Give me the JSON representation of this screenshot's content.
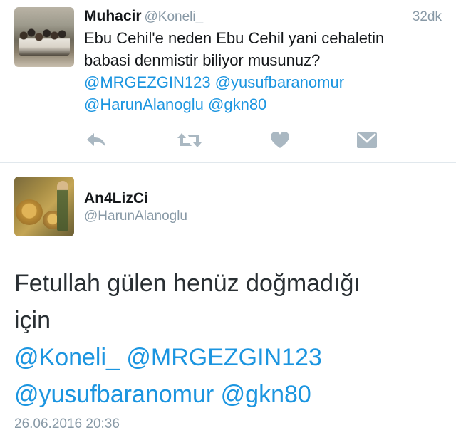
{
  "tweet1": {
    "display_name": "Muhacir",
    "handle": "@Koneli_",
    "time_ago": "32dk",
    "text_line1": "Ebu Cehil'e neden Ebu Cehil yani cehaletin",
    "text_line2": "babasi denmistir biliyor musunuz?",
    "mentions_line1": [
      "@MRGEZGIN123",
      "@yusufbaranomur"
    ],
    "mentions_line2": [
      "@HarunAlanoglu",
      "@gkn80"
    ],
    "actions": [
      "reply-icon",
      "retweet-icon",
      "like-icon",
      "direct-message-icon"
    ]
  },
  "tweet2": {
    "display_name": "An4LizCi",
    "handle": "@HarunAlanoglu",
    "text_line1": "Fetullah gülen henüz doğmadığı",
    "text_line2": "için",
    "mentions_line1": [
      "@Koneli_",
      "@MRGEZGIN123"
    ],
    "mentions_line2": [
      "@yusufbaranomur",
      "@gkn80"
    ],
    "timestamp": "26.06.2016 20:36"
  },
  "colors": {
    "mention": "#1b95e0",
    "secondary_text": "#8899a6",
    "icon": "#aab8c2",
    "divider": "#e1e8ed"
  }
}
